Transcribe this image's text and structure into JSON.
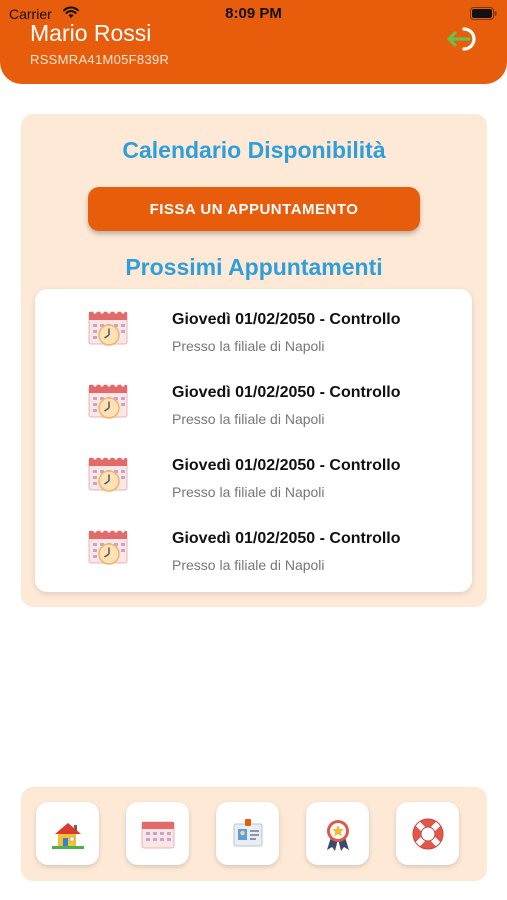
{
  "status_bar": {
    "carrier": "Carrier",
    "time": "8:09 PM"
  },
  "header": {
    "name": "Mario Rossi",
    "code": "RSSMRA41M05F839R"
  },
  "main": {
    "calendar_title": "Calendario Disponibilità",
    "book_button": "FISSA UN APPUNTAMENTO",
    "appointments_title": "Prossimi Appuntamenti",
    "appointments": [
      {
        "title": "Giovedì 01/02/2050 - Controllo",
        "subtitle": "Presso la filiale di Napoli"
      },
      {
        "title": "Giovedì 01/02/2050 - Controllo",
        "subtitle": "Presso la filiale di Napoli"
      },
      {
        "title": "Giovedì 01/02/2050 - Controllo",
        "subtitle": "Presso la filiale di Napoli"
      },
      {
        "title": "Giovedì 01/02/2050 - Controllo",
        "subtitle": "Presso la filiale di Napoli"
      }
    ]
  },
  "bottom_nav": {
    "items": [
      {
        "icon": "home-icon"
      },
      {
        "icon": "calendar-icon"
      },
      {
        "icon": "id-badge-icon"
      },
      {
        "icon": "award-icon"
      },
      {
        "icon": "lifebuoy-icon"
      }
    ]
  },
  "colors": {
    "brand": "#e85d0c",
    "accent": "#2e9fd9",
    "panel": "#fde9d6"
  }
}
